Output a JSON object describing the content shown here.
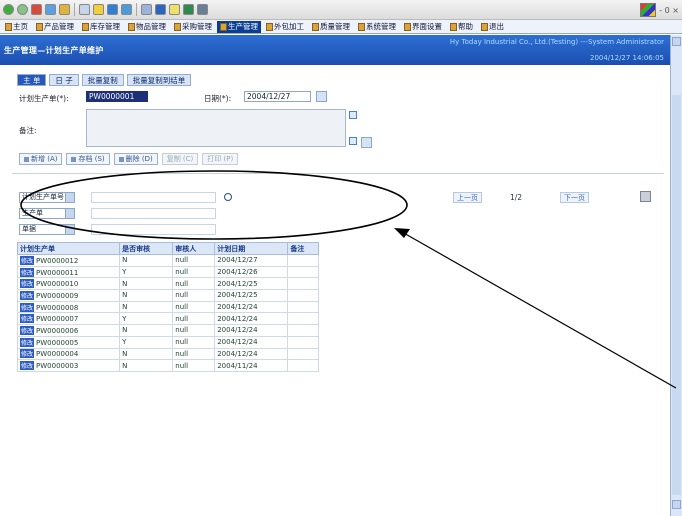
{
  "toolbar": {
    "window_controls": "- 0 ×"
  },
  "nav": {
    "items": [
      {
        "label": "主页"
      },
      {
        "label": "产品管理"
      },
      {
        "label": "库存管理"
      },
      {
        "label": "物品管理"
      },
      {
        "label": "采购管理"
      },
      {
        "label": "生产管理",
        "active": true
      },
      {
        "label": "外包加工"
      },
      {
        "label": "质量管理"
      },
      {
        "label": "系统管理"
      },
      {
        "label": "界面设置"
      },
      {
        "label": "帮助"
      },
      {
        "label": "退出"
      }
    ]
  },
  "header": {
    "title": "生产管理—计划生产单维护",
    "company": "Hy Today Industrial Co., Ltd.(Testing) ---System Administrator",
    "date": "2004/12/27 14:06:05"
  },
  "tabs": [
    {
      "label": "主 单",
      "active": true
    },
    {
      "label": "日 子"
    },
    {
      "label": "批量复制"
    },
    {
      "label": "批量复制到结单"
    }
  ],
  "form": {
    "plan_no_label": "计划生产单(*):",
    "plan_no_value": "PW0000001",
    "date_label": "日期(*):",
    "date_value": "2004/12/27",
    "memo_label": "备注:"
  },
  "actions": {
    "btn1": "新增 (A)",
    "btn2": "存档 (S)",
    "btn3": "删除 (D)",
    "btn4": "复制 (C)",
    "btn5": "打印 (P)"
  },
  "filter": {
    "dd1": "计划生产单号",
    "dd2": "生产单",
    "dd3": "单据"
  },
  "pager": {
    "prev": "上一页",
    "page": "1/2",
    "next": "下一页"
  },
  "grid": {
    "columns": [
      "计划生产单",
      "是否审核",
      "审核人",
      "计划日期",
      "备注"
    ],
    "row_button": "修改",
    "rows": [
      [
        "PW0000012",
        "N",
        "null",
        "2004/12/27",
        ""
      ],
      [
        "PW0000011",
        "Y",
        "null",
        "2004/12/26",
        ""
      ],
      [
        "PW0000010",
        "N",
        "null",
        "2004/12/25",
        ""
      ],
      [
        "PW0000009",
        "N",
        "null",
        "2004/12/25",
        ""
      ],
      [
        "PW0000008",
        "N",
        "null",
        "2004/12/24",
        ""
      ],
      [
        "PW0000007",
        "Y",
        "null",
        "2004/12/24",
        ""
      ],
      [
        "PW0000006",
        "N",
        "null",
        "2004/12/24",
        ""
      ],
      [
        "PW0000005",
        "Y",
        "null",
        "2004/12/24",
        ""
      ],
      [
        "PW0000004",
        "N",
        "null",
        "2004/12/24",
        ""
      ],
      [
        "PW0000003",
        "N",
        "null",
        "2004/11/24",
        ""
      ]
    ]
  },
  "colors": {
    "title_bar": "#1f56b8",
    "nav_active": "#0a3d94",
    "annotation": "#000000"
  }
}
